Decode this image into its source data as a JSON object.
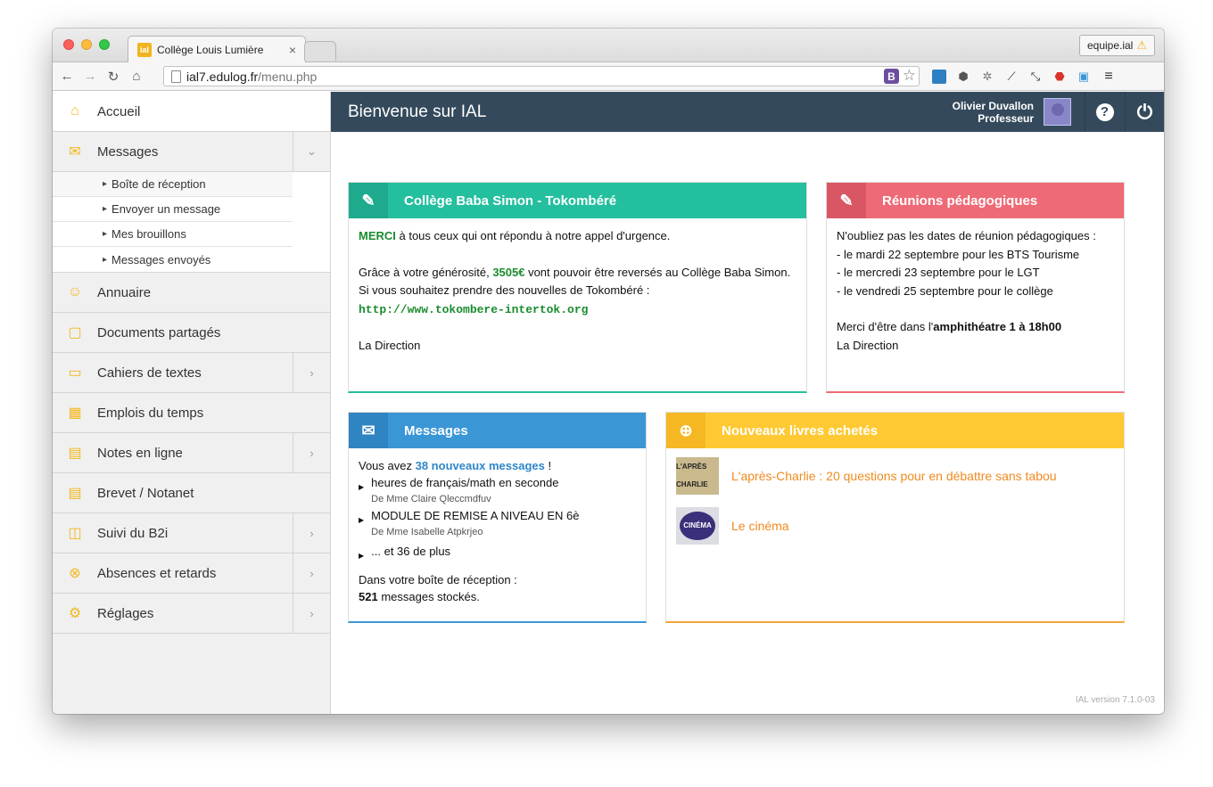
{
  "browser": {
    "tab_title": "Collège Louis Lumière",
    "tab_favicon": "ial",
    "tab_close": "×",
    "profile_label": "equipe.ial",
    "url_domain": "ial7.edulog.fr",
    "url_path": "/menu.php",
    "bookmark_ext": "B"
  },
  "sidebar": {
    "items": [
      {
        "label": "Accueil",
        "icon": "home-icon"
      },
      {
        "label": "Messages",
        "icon": "envelope-icon"
      },
      {
        "label": "Annuaire",
        "icon": "people-icon"
      },
      {
        "label": "Documents partagés",
        "icon": "folder-icon"
      },
      {
        "label": "Cahiers de textes",
        "icon": "notebook-icon"
      },
      {
        "label": "Emplois du temps",
        "icon": "calendar-icon"
      },
      {
        "label": "Notes en ligne",
        "icon": "grades-icon"
      },
      {
        "label": "Brevet / Notanet",
        "icon": "exam-icon"
      },
      {
        "label": "Suivi du B2i",
        "icon": "b2i-icon"
      },
      {
        "label": "Absences et retards",
        "icon": "absence-icon"
      },
      {
        "label": "Réglages",
        "icon": "gears-icon"
      }
    ],
    "messages_sub": [
      "Boîte de réception",
      "Envoyer un message",
      "Mes brouillons",
      "Messages envoyés"
    ]
  },
  "header": {
    "welcome": "Bienvenue sur IAL",
    "user_name": "Olivier Duvallon",
    "user_role": "Professeur"
  },
  "panels": {
    "college": {
      "title": "Collège Baba Simon - Tokombéré",
      "color": "#24bf9e",
      "merci": "MERCI",
      "line1": " à tous ceux qui ont répondu à notre appel d'urgence.",
      "line2a": "Grâce à votre générosité, ",
      "amount": "3505€",
      "line2b": " vont pouvoir être reversés au Collège Baba Simon.",
      "line3": "Si vous souhaitez prendre des nouvelles de Tokombéré :",
      "link": "http://www.tokombere-intertok.org",
      "signature": "La Direction"
    },
    "reunions": {
      "title": "Réunions pédagogiques",
      "color": "#ee6a76",
      "intro": "N'oubliez pas les dates de réunion pédagogiques :",
      "dates": [
        "- le mardi 22 septembre pour les BTS Tourisme",
        "- le mercredi 23 septembre pour le LGT",
        "- le vendredi 25 septembre pour le collège"
      ],
      "place_prefix": "Merci d'être dans l'",
      "place": "amphithéatre 1 à 18h00",
      "signature": "La Direction"
    },
    "messages": {
      "title": "Messages",
      "color": "#3b96d6",
      "prefix": "Vous avez ",
      "count_link": "38 nouveaux messages",
      "suffix": " !",
      "items": [
        {
          "subject": "heures de français/math en seconde",
          "from": "De Mme Claire Qleccmdfuv"
        },
        {
          "subject": "MODULE DE REMISE A NIVEAU EN 6è",
          "from": "De Mme Isabelle Atpkrjeo"
        }
      ],
      "more": "... et 36 de plus",
      "inbox_label": "Dans votre boîte de réception :",
      "stored_count": "521",
      "stored_suffix": " messages stockés."
    },
    "books": {
      "title": "Nouveaux livres achetés",
      "color": "#ffc933",
      "items": [
        {
          "title": "L'après-Charlie : 20 questions pour en débattre sans tabou",
          "cover": "L'APRÈS CHARLIE"
        },
        {
          "title": "Le cinéma",
          "cover": "CINÉMA"
        }
      ]
    }
  },
  "version": "IAL version 7.1.0-03"
}
